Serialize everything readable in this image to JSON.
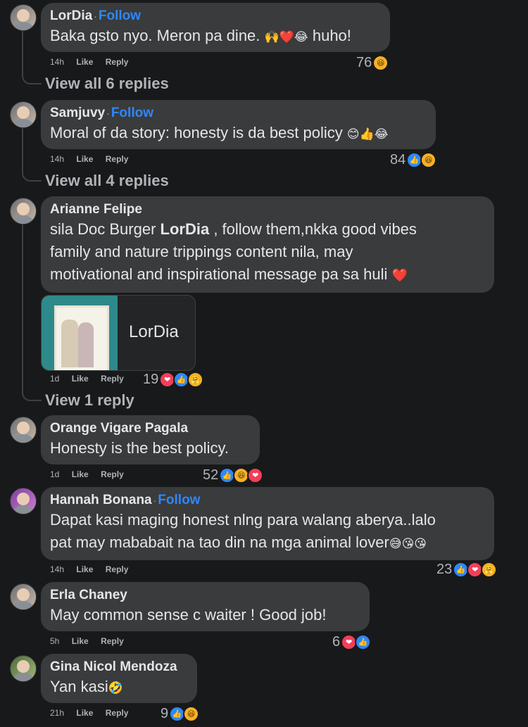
{
  "comments": [
    {
      "name": "LorDia",
      "follow": "Follow",
      "text": "Baka gsto nyo. Meron pa dine. ",
      "text_emojis": "🙌❤️😂",
      "text_tail": " huho!",
      "time": "14h",
      "like": "Like",
      "reply": "Reply",
      "reaction_count": "76",
      "reactions": [
        "haha"
      ],
      "view_replies": "View all 6 replies"
    },
    {
      "name": "Samjuvy",
      "follow": "Follow",
      "text": "Moral of da story: honesty is da best policy ",
      "text_emojis": "😊👍😂",
      "time": "14h",
      "like": "Like",
      "reply": "Reply",
      "reaction_count": "84",
      "reactions": [
        "like",
        "haha"
      ],
      "view_replies": "View all 4 replies"
    },
    {
      "name": "Arianne Felipe",
      "text_line1_a": "sila Doc Burger ",
      "mention": "LorDia",
      "text_line1_b": " , follow them,nkka good vibes",
      "text_line2": "family and nature trippings content nila, may",
      "text_line3": "motivational and inspirational message pa sa huli ",
      "text_emojis": "❤️",
      "preview_title": "LorDia",
      "time": "1d",
      "like": "Like",
      "reply": "Reply",
      "reaction_count": "19",
      "reactions": [
        "love",
        "like",
        "care"
      ],
      "view_replies": "View 1 reply"
    },
    {
      "name": "Orange Vigare Pagala",
      "text": "Honesty is the best policy.",
      "time": "1d",
      "like": "Like",
      "reply": "Reply",
      "reaction_count": "52",
      "reactions": [
        "like",
        "haha",
        "love"
      ]
    },
    {
      "name": "Hannah Bonana",
      "follow": "Follow",
      "text_line1": "Dapat kasi maging honest nlng para walang aberya..lalo",
      "text_line2": "pat may mababait na tao din na mga animal lover",
      "text_emojis": "😅😘😘",
      "time": "14h",
      "like": "Like",
      "reply": "Reply",
      "reaction_count": "23",
      "reactions": [
        "like",
        "love",
        "care"
      ]
    },
    {
      "name": "Erla Chaney",
      "text": "May common sense c waiter ! Good job!",
      "time": "5h",
      "like": "Like",
      "reply": "Reply",
      "reaction_count": "6",
      "reactions": [
        "love",
        "like"
      ]
    },
    {
      "name": "Gina Nicol Mendoza",
      "text": "Yan kasi",
      "text_emojis": "🤣",
      "time": "21h",
      "like": "Like",
      "reply": "Reply",
      "reaction_count": "9",
      "reactions": [
        "like",
        "haha"
      ]
    }
  ],
  "reaction_icons": {
    "like": "👍",
    "love": "❤",
    "haha": "😆",
    "care": "🤗"
  }
}
